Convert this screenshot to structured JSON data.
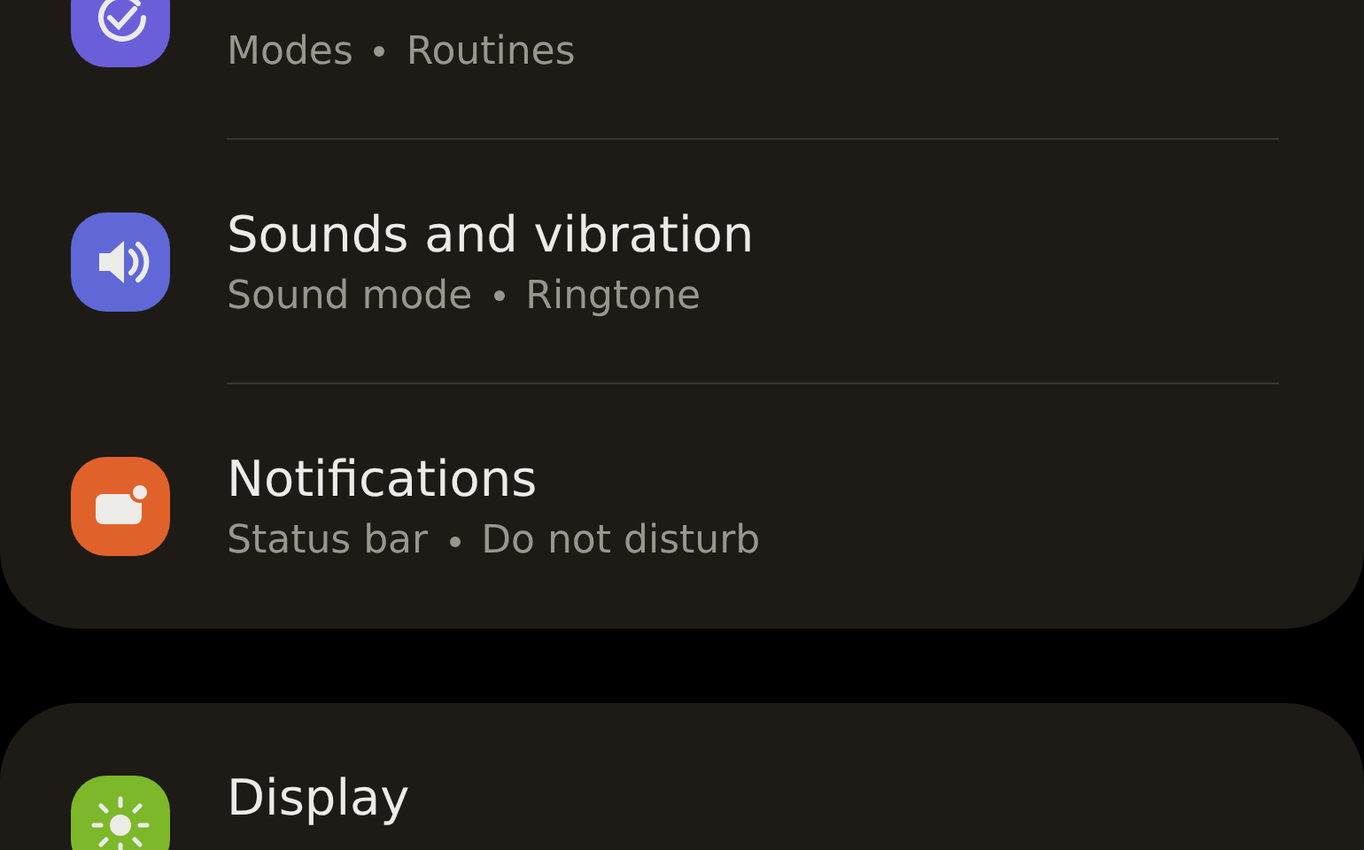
{
  "groups": [
    {
      "items": [
        {
          "subtitle": [
            "Modes",
            "Routines"
          ],
          "kind": "modes",
          "color": "#6a5fd8"
        },
        {
          "title": "Sounds and vibration",
          "subtitle": [
            "Sound mode",
            "Ringtone"
          ],
          "kind": "sound",
          "color": "#5f68d6"
        },
        {
          "title": "Notifications",
          "subtitle": [
            "Status bar",
            "Do not disturb"
          ],
          "kind": "notifications",
          "color": "#e0622a"
        }
      ]
    },
    {
      "items": [
        {
          "title": "Display",
          "kind": "display",
          "color": "#7cb82a"
        }
      ]
    }
  ]
}
